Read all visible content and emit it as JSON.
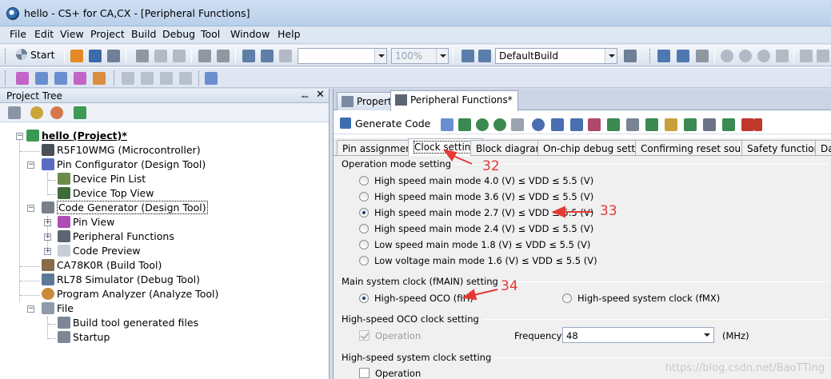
{
  "window": {
    "title": "hello - CS+ for CA,CX - [Peripheral Functions]"
  },
  "menu": [
    "File",
    "Edit",
    "View",
    "Project",
    "Build",
    "Debug",
    "Tool",
    "Window",
    "Help"
  ],
  "toolbar": {
    "start_label": "Start",
    "zoom_value": "100%",
    "build_config": "DefaultBuild"
  },
  "project_tree": {
    "title": "Project Tree",
    "pin_glyph": "ᅭ",
    "close_glyph": "✕",
    "nodes": [
      {
        "label": "hello (Project)*",
        "icon": "project-icon"
      },
      {
        "label": "R5F10WMG (Microcontroller)",
        "icon": "microcontroller-icon"
      },
      {
        "label": "Pin Configurator (Design Tool)",
        "icon": "pin-configurator-icon"
      },
      {
        "label": "Device Pin List",
        "icon": "pin-list-icon"
      },
      {
        "label": "Device Top View",
        "icon": "top-view-icon"
      },
      {
        "label": "Code Generator (Design Tool)",
        "icon": "code-generator-icon"
      },
      {
        "label": "Pin View",
        "icon": "pin-view-icon"
      },
      {
        "label": "Peripheral Functions",
        "icon": "peripheral-functions-icon"
      },
      {
        "label": "Code Preview",
        "icon": "code-preview-icon"
      },
      {
        "label": "CA78K0R (Build Tool)",
        "icon": "build-tool-icon"
      },
      {
        "label": "RL78 Simulator (Debug Tool)",
        "icon": "debug-tool-icon"
      },
      {
        "label": "Program Analyzer (Analyze Tool)",
        "icon": "analyze-tool-icon"
      },
      {
        "label": "File",
        "icon": "folder-icon"
      },
      {
        "label": "Build tool generated files",
        "icon": "folder-icon"
      },
      {
        "label": "Startup",
        "icon": "folder-icon"
      }
    ]
  },
  "doc_tabs": [
    "Property",
    "Peripheral Functions*"
  ],
  "generate_code_label": "Generate Code",
  "sub_tabs": [
    "Pin assignment",
    "Clock setting",
    "Block diagram",
    "On-chip debug setting",
    "Confirming reset source",
    "Safety functions",
    "Da"
  ],
  "operation_mode": {
    "title": "Operation mode setting",
    "options": [
      "High speed main mode 4.0 (V) ≤ VDD ≤ 5.5 (V)",
      "High speed main mode 3.6 (V) ≤ VDD ≤ 5.5 (V)",
      "High speed main mode 2.7 (V) ≤ VDD ≤ 5.5 (V)",
      "High speed main mode 2.4 (V) ≤ VDD ≤ 5.5 (V)",
      "Low speed main mode 1.8 (V) ≤ VDD ≤ 5.5 (V)",
      "Low voltage main mode 1.6 (V) ≤ VDD ≤ 5.5 (V)"
    ],
    "selected_index": 2
  },
  "main_clock": {
    "title": "Main system clock (fMAIN) setting",
    "option_oco": "High-speed OCO (fIH)",
    "option_fmx": "High-speed system clock (fMX)"
  },
  "oco_setting": {
    "title": "High-speed OCO clock setting",
    "operation_label": "Operation",
    "frequency_label": "Frequency",
    "frequency_value": "48",
    "unit": "(MHz)"
  },
  "system_clock_setting": {
    "title": "High-speed system clock setting",
    "operation_label": "Operation"
  },
  "annotations": [
    "32",
    "33",
    "34"
  ],
  "watermark": "https://blog.csdn.net/BaoTTing",
  "colors": {
    "annotation": "#e53935",
    "panel_bg": "#f0f0f0"
  }
}
